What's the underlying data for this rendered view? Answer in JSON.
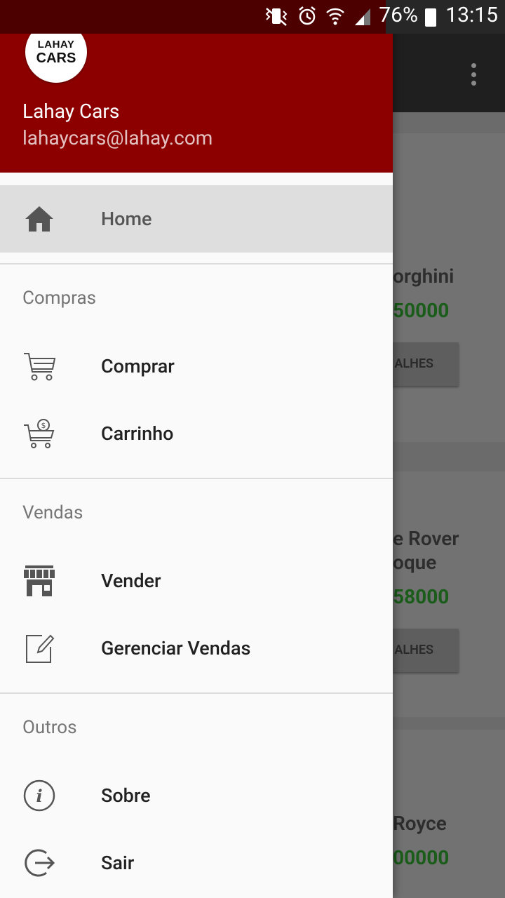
{
  "status_bar": {
    "battery": "76%",
    "time": "13:15"
  },
  "drawer": {
    "logo": {
      "line1": "LAHAY",
      "line2": "CARS"
    },
    "user_name": "Lahay Cars",
    "user_email": "lahaycars@lahay.com",
    "home": {
      "label": "Home",
      "icon": "home-icon"
    },
    "sections": [
      {
        "title": "Compras",
        "items": [
          {
            "label": "Comprar",
            "icon": "shopping-cart-icon"
          },
          {
            "label": "Carrinho",
            "icon": "cart-dollar-icon"
          }
        ]
      },
      {
        "title": "Vendas",
        "items": [
          {
            "label": "Vender",
            "icon": "store-icon"
          },
          {
            "label": "Gerenciar Vendas",
            "icon": "edit-icon"
          }
        ]
      },
      {
        "title": "Outros",
        "items": [
          {
            "label": "Sobre",
            "icon": "info-icon"
          },
          {
            "label": "Sair",
            "icon": "logout-icon"
          }
        ]
      }
    ]
  },
  "background": {
    "cars": [
      {
        "name": "orghini",
        "price": "50000",
        "button": "ALHES"
      },
      {
        "name_line1": "e Rover",
        "name_line2": "oque",
        "price": "58000",
        "button": "ALHES"
      },
      {
        "name": "Royce",
        "price": "00000"
      }
    ]
  },
  "colors": {
    "header": "#8c0000",
    "price": "#1a5c1a"
  }
}
